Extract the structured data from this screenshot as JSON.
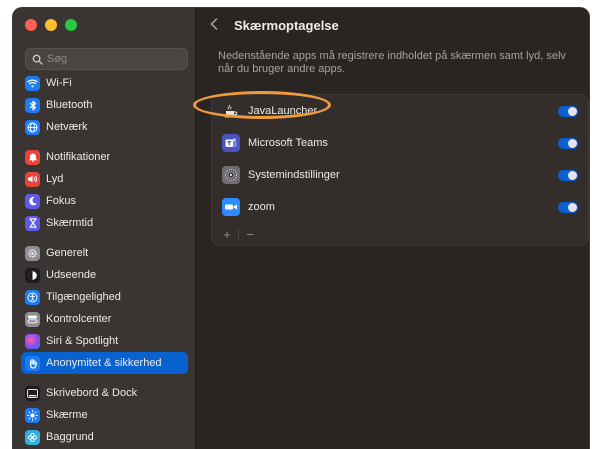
{
  "window": {
    "title": "Skærmoptagelse"
  },
  "search": {
    "placeholder": "Søg"
  },
  "sidebar": {
    "items": [
      {
        "label": "Wi-Fi",
        "icon": "wifi-icon",
        "color": "#1c7bf5"
      },
      {
        "label": "Bluetooth",
        "icon": "bluetooth-icon",
        "color": "#1c7bf5"
      },
      {
        "label": "Netværk",
        "icon": "globe-icon",
        "color": "#1c7bf5"
      },
      {
        "label": "Notifikationer",
        "icon": "bell-icon",
        "color": "#e8443a"
      },
      {
        "label": "Lyd",
        "icon": "speaker-icon",
        "color": "#e8443a"
      },
      {
        "label": "Fokus",
        "icon": "moon-icon",
        "color": "#5e5ce6"
      },
      {
        "label": "Skærmtid",
        "icon": "hourglass-icon",
        "color": "#5e5ce6"
      },
      {
        "label": "Generelt",
        "icon": "gear-icon",
        "color": "#8e8e93"
      },
      {
        "label": "Udseende",
        "icon": "appearance-icon",
        "color": "#1c1c1e"
      },
      {
        "label": "Tilgængelighed",
        "icon": "accessibility-icon",
        "color": "#1c7bf5"
      },
      {
        "label": "Kontrolcenter",
        "icon": "control-center-icon",
        "color": "#8e8e93"
      },
      {
        "label": "Siri & Spotlight",
        "icon": "siri-icon",
        "color": "#b04fd6"
      },
      {
        "label": "Anonymitet & sikkerhed",
        "icon": "hand-icon",
        "color": "#1c7bf5",
        "active": true
      },
      {
        "label": "Skrivebord & Dock",
        "icon": "dock-icon",
        "color": "#1c1c1e"
      },
      {
        "label": "Skærme",
        "icon": "sun-icon",
        "color": "#1c7bf5"
      },
      {
        "label": "Baggrund",
        "icon": "flower-icon",
        "color": "#30b0e0"
      }
    ]
  },
  "content": {
    "description": "Nedenstående apps må registrere indholdet på skærmen samt lyd, selv når du bruger andre apps.",
    "apps": [
      {
        "name": "JavaLauncher",
        "icon": "java-icon",
        "enabled": true
      },
      {
        "name": "Microsoft Teams",
        "icon": "teams-icon",
        "enabled": true
      },
      {
        "name": "Systemindstillinger",
        "icon": "system-settings-icon",
        "enabled": true
      },
      {
        "name": "zoom",
        "icon": "zoom-icon",
        "enabled": true
      }
    ],
    "add_label": "+",
    "remove_label": "−"
  },
  "colors": {
    "accent": "#0a62d0",
    "highlight": "#f09a3e"
  }
}
